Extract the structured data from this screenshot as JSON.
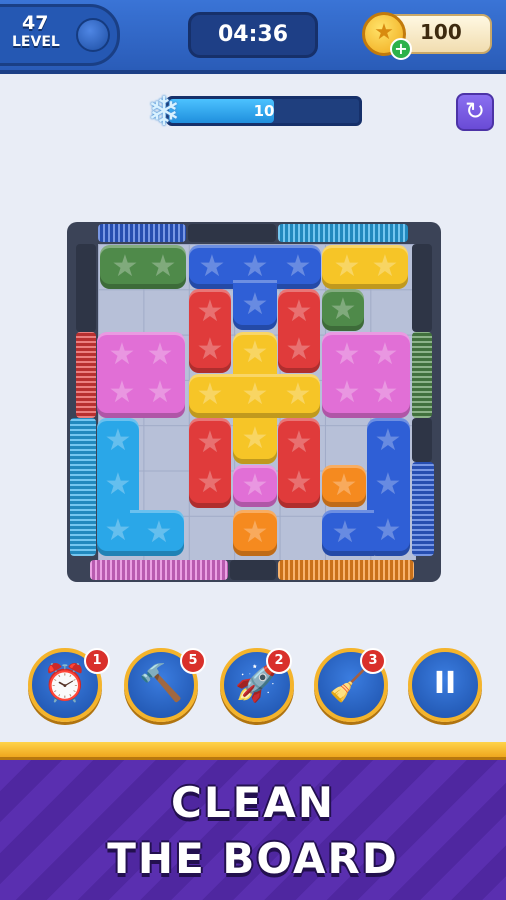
{
  "header": {
    "level_number": "47",
    "level_label": "LEVEL",
    "timer": "04:36",
    "coins": "100",
    "coin_icon": "star-coin-icon",
    "add_coins_icon": "plus-icon"
  },
  "freeze": {
    "value": "10",
    "fill_fraction": 0.55,
    "icon": "snowflake-icon"
  },
  "restart": {
    "icon": "restart-icon"
  },
  "board": {
    "piece_colors": {
      "green": "#4f8a4a",
      "blue": "#2f5fd6",
      "yellow": "#f6c527",
      "red": "#e03b3b",
      "pink": "#e16fd6",
      "cyan": "#2aa7e8",
      "orange": "#f58a1f"
    }
  },
  "boosters": [
    {
      "icon": "alarm-clock-icon",
      "count": "1"
    },
    {
      "icon": "hammer-icon",
      "count": "5"
    },
    {
      "icon": "rocket-icon",
      "count": "2"
    },
    {
      "icon": "vacuum-icon",
      "count": "3"
    }
  ],
  "pause": {
    "label": "II",
    "icon": "pause-icon"
  },
  "banner": {
    "line1": "CLEAN",
    "line2": "THE BOARD"
  }
}
